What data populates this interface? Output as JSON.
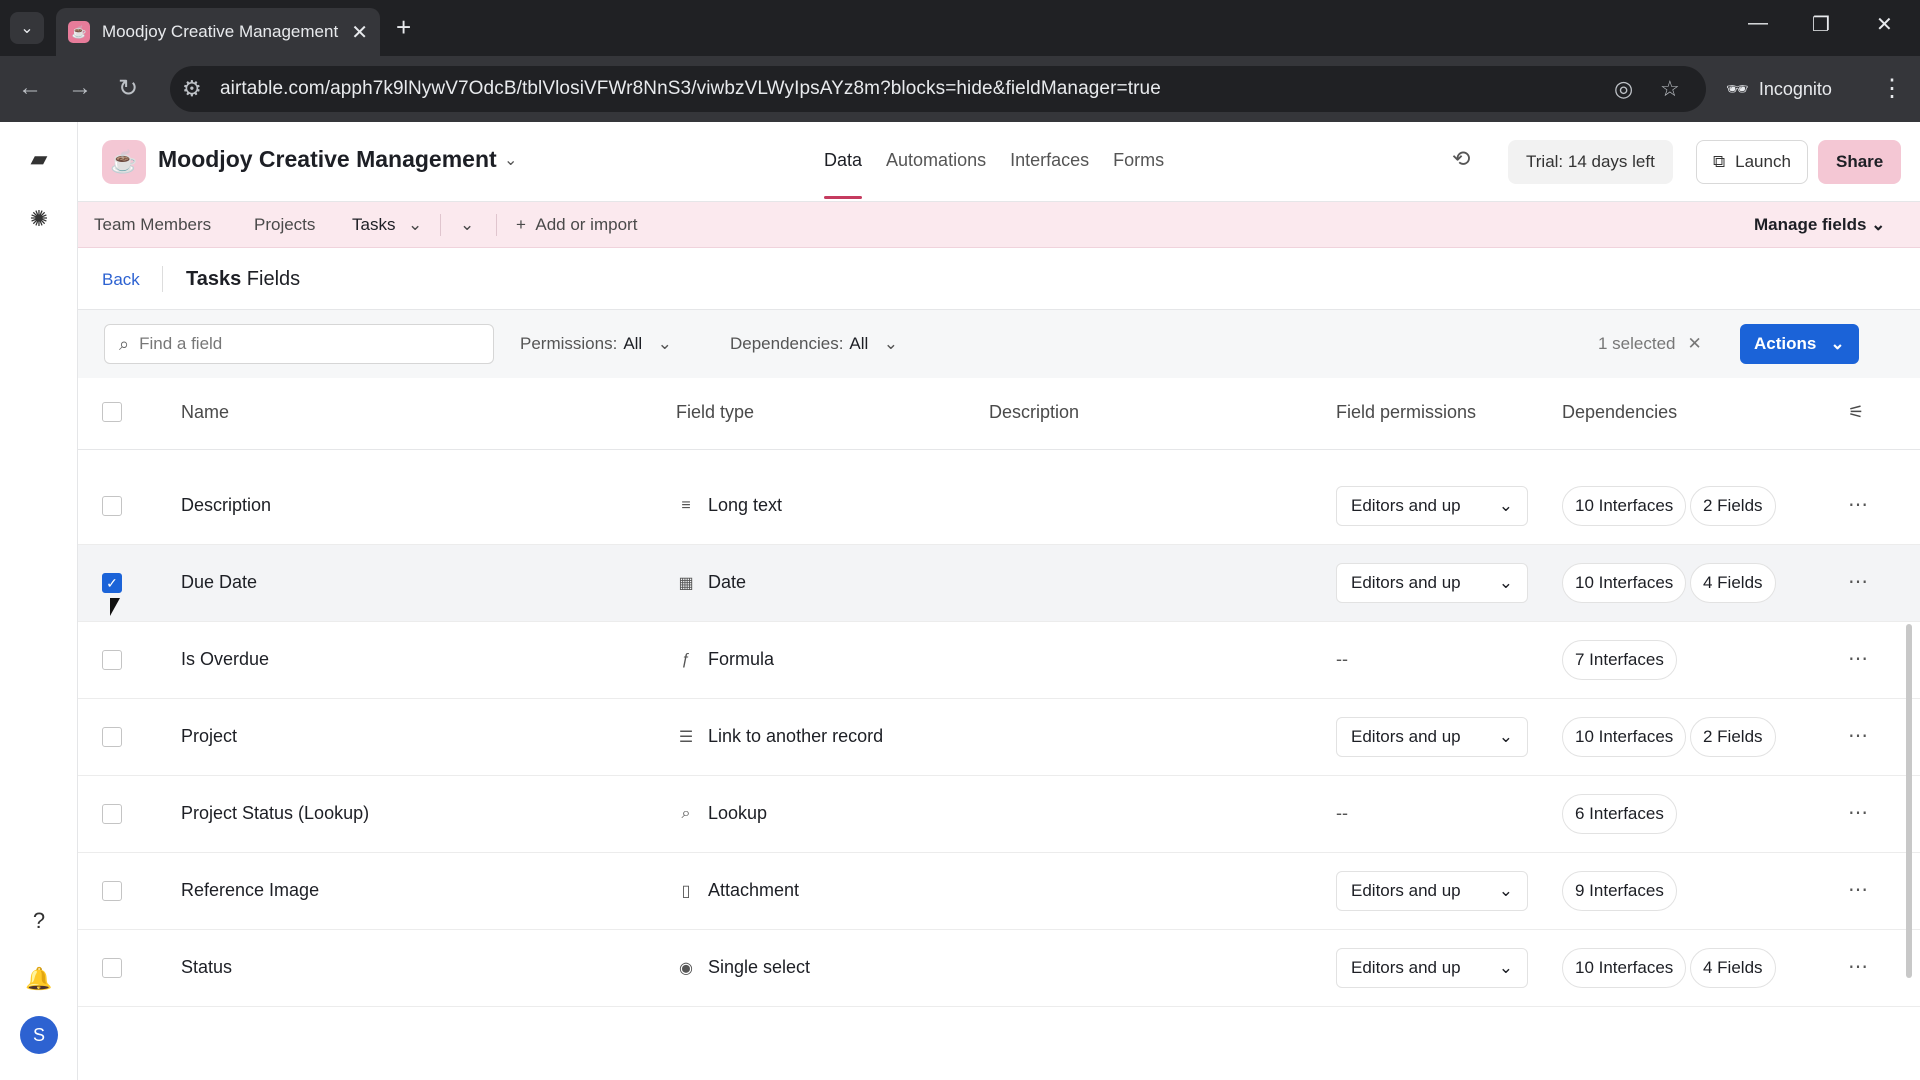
{
  "browser": {
    "tab_title": "Moodjoy Creative Management",
    "url": "airtable.com/apph7k9lNywV7OdcB/tblVlosiVFWr8NnS3/viwbzVLWyIpsAYz8m?blocks=hide&fieldManager=true",
    "incognito_label": "Incognito"
  },
  "app": {
    "base_name": "Moodjoy Creative Management",
    "nav": [
      "Data",
      "Automations",
      "Interfaces",
      "Forms"
    ],
    "active_nav": "Data",
    "trial_label": "Trial: 14 days left",
    "launch_label": "Launch",
    "share_label": "Share"
  },
  "tables": {
    "items": [
      "Team Members",
      "Projects",
      "Tasks"
    ],
    "active": "Tasks",
    "add_label": "Add or import",
    "manage_label": "Manage fields"
  },
  "subhead": {
    "back_label": "Back",
    "title_table": "Tasks",
    "title_suffix": "Fields"
  },
  "filters": {
    "search_placeholder": "Find a field",
    "permissions_label": "Permissions:",
    "permissions_value": "All",
    "dependencies_label": "Dependencies:",
    "dependencies_value": "All",
    "selected_text": "1 selected",
    "actions_label": "Actions"
  },
  "columns": [
    "Name",
    "Field type",
    "Description",
    "Field permissions",
    "Dependencies"
  ],
  "rows": [
    {
      "name": "Description",
      "type": "Long text",
      "icon": "long-text-icon",
      "glyph": "≡",
      "perm": "Editors and up",
      "deps": [
        "10 Interfaces",
        "2 Fields"
      ],
      "checked": false
    },
    {
      "name": "Due Date",
      "type": "Date",
      "icon": "calendar-icon",
      "glyph": "▦",
      "perm": "Editors and up",
      "deps": [
        "10 Interfaces",
        "4 Fields"
      ],
      "checked": true
    },
    {
      "name": "Is Overdue",
      "type": "Formula",
      "icon": "formula-icon",
      "glyph": "ƒ",
      "perm": "--",
      "deps": [
        "7 Interfaces"
      ],
      "checked": false
    },
    {
      "name": "Project",
      "type": "Link to another record",
      "icon": "link-record-icon",
      "glyph": "☰",
      "perm": "Editors and up",
      "deps": [
        "10 Interfaces",
        "2 Fields"
      ],
      "checked": false
    },
    {
      "name": "Project Status (Lookup)",
      "type": "Lookup",
      "icon": "lookup-icon",
      "glyph": "⌕",
      "perm": "--",
      "deps": [
        "6 Interfaces"
      ],
      "checked": false
    },
    {
      "name": "Reference Image",
      "type": "Attachment",
      "icon": "attachment-icon",
      "glyph": "▯",
      "perm": "Editors and up",
      "deps": [
        "9 Interfaces"
      ],
      "checked": false
    },
    {
      "name": "Status",
      "type": "Single select",
      "icon": "single-select-icon",
      "glyph": "◉",
      "perm": "Editors and up",
      "deps": [
        "10 Interfaces",
        "4 Fields"
      ],
      "checked": false
    }
  ],
  "colors": {
    "accent": "#1b63d8",
    "brand_pink": "#f4c7d4",
    "tablebar_bg": "#fbe9ee"
  }
}
